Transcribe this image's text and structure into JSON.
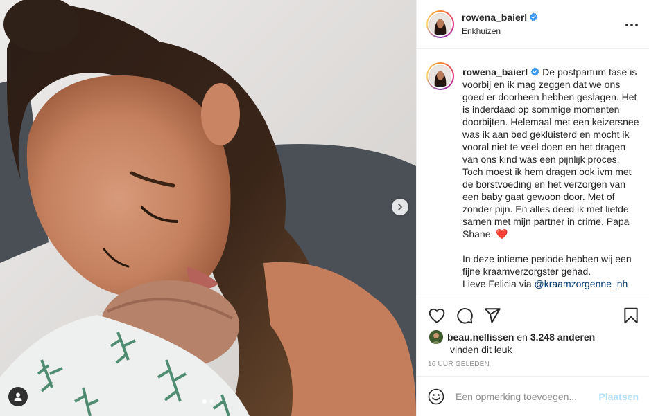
{
  "post": {
    "username": "rowena_baierl",
    "location": "Enkhuizen",
    "verified": true,
    "image_alt": "Mother resting her face on her newborn wrapped in a leaf-patterned swaddle",
    "carousel": {
      "total": 2,
      "current": 1
    }
  },
  "caption": {
    "username": "rowena_baierl",
    "text": "De postpartum fase is voorbij en ik mag zeggen dat we ons goed er doorheen hebben geslagen. Het is inderdaad op sommige momenten doorbijten. Helemaal met een keizersnee was ik aan bed gekluisterd en mocht ik vooral niet te veel doen en het dragen van ons kind was een pijnlijk proces. Toch moest ik hem dragen ook ivm met de borstvoeding en het verzorgen van een baby gaat gewoon door. Met of zonder pijn. En alles deed ik met liefde samen met mijn partner in crime, Papa Shane. ❤️",
    "text2": "In deze intieme periode hebben wij een fijne kraamverzorgster gehad.",
    "text3_start": "Lieve Felicia via ",
    "mention": "@kraamzorgenne_nh"
  },
  "likes": {
    "user": "beau.nellissen",
    "connector": "en",
    "others": "3.248 anderen",
    "suffix": "vinden dit leuk"
  },
  "timestamp": "16 UUR GELEDEN",
  "comment": {
    "placeholder": "Een opmerking toevoegen...",
    "post_label": "Plaatsen"
  },
  "colors": {
    "verified": "#3897f0",
    "post_button_disabled": "#b2dffc",
    "muted_text": "#8e8e8e",
    "divider": "#efefef"
  },
  "icons": [
    "heart-icon",
    "comment-icon",
    "share-icon",
    "bookmark-icon",
    "more-icon",
    "emoji-icon",
    "chevron-right-icon",
    "user-tag-icon",
    "verified-icon"
  ]
}
